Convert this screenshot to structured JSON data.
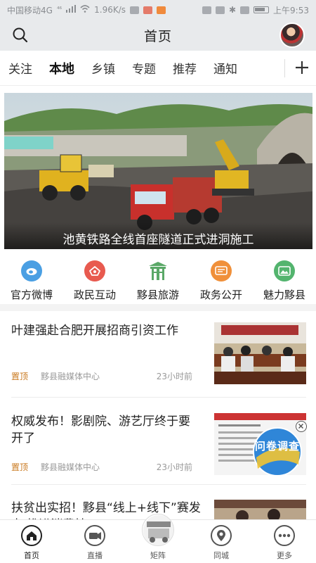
{
  "status_bar": {
    "carrier": "中国移动4G",
    "signal_tag": "⁴⁶",
    "speed": "1.96K/s",
    "time": "上午9:53",
    "icons": [
      "signal-icon",
      "wifi-icon",
      "app-notify-icon",
      "nfc-icon",
      "bluetooth-icon",
      "vibrate-icon",
      "battery-icon"
    ]
  },
  "header": {
    "title": "首页",
    "search_icon": "search-icon",
    "avatar_icon": "user-avatar"
  },
  "tabs": {
    "items": [
      "关注",
      "本地",
      "乡镇",
      "专题",
      "推荐",
      "通知"
    ],
    "active": "本地",
    "add_icon": "plus-icon"
  },
  "banner": {
    "caption": "池黄铁路全线首座隧道正式进洞施工"
  },
  "quick_links": [
    {
      "label": "官方微博",
      "icon": "weibo-icon",
      "color": "#4a9fe3"
    },
    {
      "label": "政民互动",
      "icon": "interaction-icon",
      "color": "#e85a4f"
    },
    {
      "label": "黟县旅游",
      "icon": "archway-icon",
      "color": "#5aa867"
    },
    {
      "label": "政务公开",
      "icon": "government-icon",
      "color": "#f0903a"
    },
    {
      "label": "魅力黟县",
      "icon": "landscape-icon",
      "color": "#53b46e"
    }
  ],
  "news": [
    {
      "title": "叶建强赴合肥开展招商引资工作",
      "pin": "置顶",
      "source": "黟县融媒体中心",
      "time": "23小时前"
    },
    {
      "title": "权威发布！影剧院、游艺厅终于要开了",
      "pin": "置顶",
      "source": "黟县融媒体中心",
      "time": "23小时前"
    },
    {
      "title": "扶贫出实招！黟县“线上+线下”赛发力 推进消费扶",
      "pin": "",
      "source": "",
      "time": ""
    }
  ],
  "float_ad": {
    "label": "问卷调查",
    "close_icon": "close-icon"
  },
  "bottom_nav": [
    {
      "label": "首页",
      "icon": "home-icon",
      "active": true
    },
    {
      "label": "直播",
      "icon": "live-camera-icon",
      "active": false
    },
    {
      "label": "矩阵",
      "icon": "matrix-icon",
      "active": false
    },
    {
      "label": "同城",
      "icon": "city-icon",
      "active": false
    },
    {
      "label": "更多",
      "icon": "more-icon",
      "active": false
    }
  ],
  "colors": {
    "header_bg": "#e8eaec",
    "pin": "#c9781e",
    "meta": "#999999"
  }
}
